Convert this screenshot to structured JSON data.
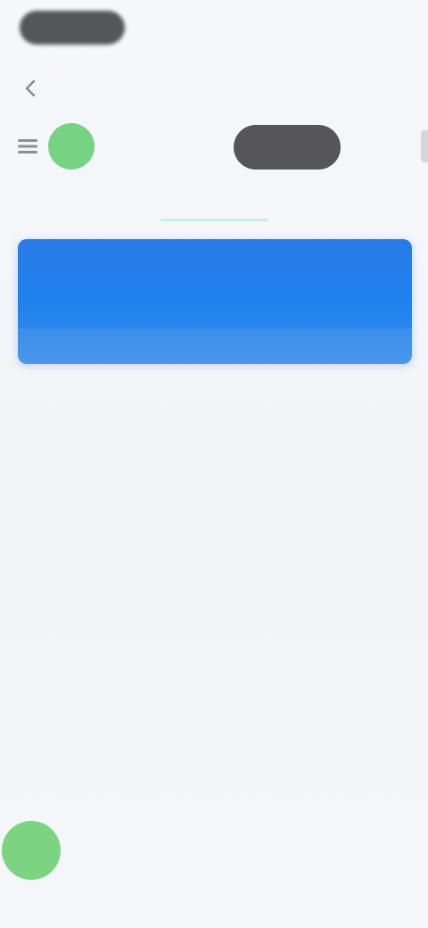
{
  "status_bar": {
    "time": ""
  },
  "nav": {
    "title": ""
  },
  "toolbar": {
    "filter_label": "",
    "more_label": ""
  },
  "tabs": [
    {
      "label": "",
      "active": false
    },
    {
      "label": "",
      "active": true
    },
    {
      "label": "",
      "active": false
    }
  ],
  "banner": {
    "items": [
      "",
      "",
      "",
      ""
    ]
  },
  "article": {
    "title": "",
    "body": ""
  },
  "info_grid": {
    "rows": [
      {
        "left": "",
        "right": ""
      },
      {
        "left": "",
        "right": ""
      },
      {
        "left": "",
        "right": ""
      },
      {
        "left": "",
        "right": ""
      }
    ]
  },
  "bottom_bar": {
    "left_label": "",
    "right_label": ""
  },
  "colors": {
    "accent_green": "#5fcd6e",
    "banner_blue": "#1d82f0",
    "chip_dark": "#48484a",
    "background": "#f3f4f8"
  },
  "icons": {
    "back": "chevron-left-icon",
    "tool": "menu-icon"
  }
}
